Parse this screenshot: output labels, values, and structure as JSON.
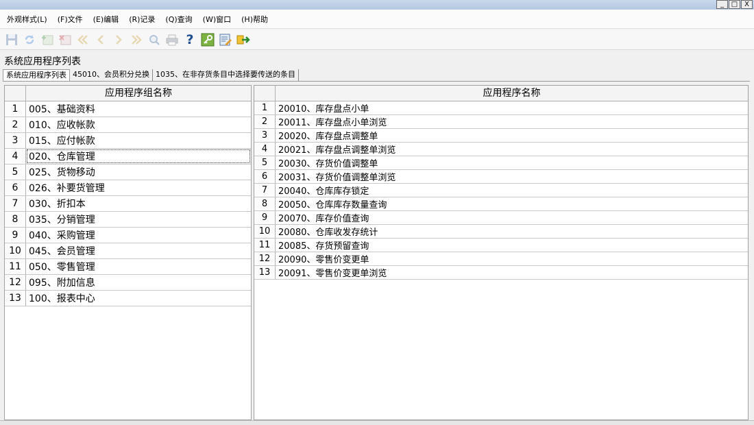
{
  "window": {
    "min": "_",
    "max": "□",
    "close": "X"
  },
  "menu": [
    {
      "label": "外观样式(L)"
    },
    {
      "label": "(F)文件"
    },
    {
      "label": "(E)编辑"
    },
    {
      "label": "(R)记录"
    },
    {
      "label": "(Q)查询"
    },
    {
      "label": "(W)窗口"
    },
    {
      "label": "(H)帮助"
    }
  ],
  "toolbar_icons": [
    "save-icon",
    "refresh-icon",
    "add-record-icon",
    "delete-record-icon",
    "first-record-icon",
    "previous-record-icon",
    "next-record-icon",
    "last-record-icon",
    "search-icon",
    "print-icon",
    "help-icon",
    "key-icon",
    "edit-note-icon",
    "exit-icon"
  ],
  "toolbar_help_label": "?",
  "page_title": "系统应用程序列表",
  "tabs": [
    {
      "label": "系统应用程序列表"
    },
    {
      "label": "45010、会员积分兑换"
    },
    {
      "label": "1035、在非存货条目中选择要传送的条目"
    }
  ],
  "left_grid": {
    "header": "应用程序组名称",
    "rows": [
      {
        "num": "1",
        "text": "005、基础资料"
      },
      {
        "num": "2",
        "text": "010、应收帐款"
      },
      {
        "num": "3",
        "text": "015、应付帐款"
      },
      {
        "num": "4",
        "text": "020、仓库管理"
      },
      {
        "num": "5",
        "text": "025、货物移动"
      },
      {
        "num": "6",
        "text": "026、补要货管理"
      },
      {
        "num": "7",
        "text": "030、折扣本"
      },
      {
        "num": "8",
        "text": "035、分销管理"
      },
      {
        "num": "9",
        "text": "040、采购管理"
      },
      {
        "num": "10",
        "text": "045、会员管理"
      },
      {
        "num": "11",
        "text": "050、零售管理"
      },
      {
        "num": "12",
        "text": "095、附加信息"
      },
      {
        "num": "13",
        "text": "100、报表中心"
      }
    ]
  },
  "right_grid": {
    "header": "应用程序名称",
    "rows": [
      {
        "num": "1",
        "text": "20010、库存盘点小单"
      },
      {
        "num": "2",
        "text": "20011、库存盘点小单浏览"
      },
      {
        "num": "3",
        "text": "20020、库存盘点调整单"
      },
      {
        "num": "4",
        "text": "20021、库存盘点调整单浏览"
      },
      {
        "num": "5",
        "text": "20030、存货价值调整单"
      },
      {
        "num": "6",
        "text": "20031、存货价值调整单浏览"
      },
      {
        "num": "7",
        "text": "20040、仓库库存锁定"
      },
      {
        "num": "8",
        "text": "20050、仓库库存数量查询"
      },
      {
        "num": "9",
        "text": "20070、库存价值查询"
      },
      {
        "num": "10",
        "text": "20080、仓库收发存统计"
      },
      {
        "num": "11",
        "text": "20085、存货预留查询"
      },
      {
        "num": "12",
        "text": "20090、零售价变更单"
      },
      {
        "num": "13",
        "text": "20091、零售价变更单浏览"
      }
    ]
  }
}
